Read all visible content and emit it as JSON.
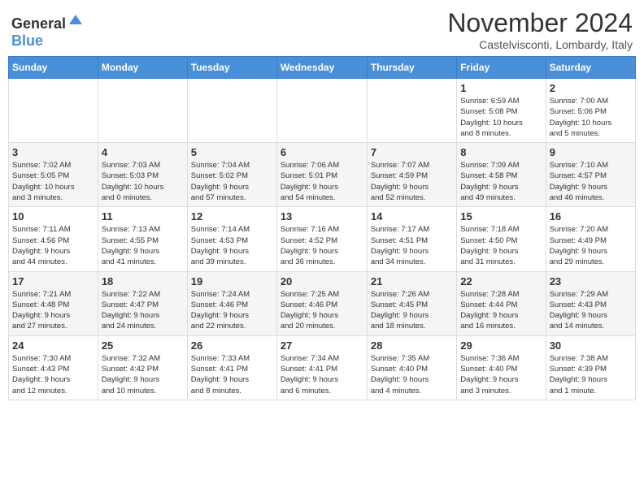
{
  "header": {
    "logo_general": "General",
    "logo_blue": "Blue",
    "title": "November 2024",
    "subtitle": "Castelvisconti, Lombardy, Italy"
  },
  "columns": [
    "Sunday",
    "Monday",
    "Tuesday",
    "Wednesday",
    "Thursday",
    "Friday",
    "Saturday"
  ],
  "rows": [
    {
      "cells": [
        {
          "day": "",
          "info": ""
        },
        {
          "day": "",
          "info": ""
        },
        {
          "day": "",
          "info": ""
        },
        {
          "day": "",
          "info": ""
        },
        {
          "day": "",
          "info": ""
        },
        {
          "day": "1",
          "info": "Sunrise: 6:59 AM\nSunset: 5:08 PM\nDaylight: 10 hours\nand 8 minutes."
        },
        {
          "day": "2",
          "info": "Sunrise: 7:00 AM\nSunset: 5:06 PM\nDaylight: 10 hours\nand 5 minutes."
        }
      ]
    },
    {
      "cells": [
        {
          "day": "3",
          "info": "Sunrise: 7:02 AM\nSunset: 5:05 PM\nDaylight: 10 hours\nand 3 minutes."
        },
        {
          "day": "4",
          "info": "Sunrise: 7:03 AM\nSunset: 5:03 PM\nDaylight: 10 hours\nand 0 minutes."
        },
        {
          "day": "5",
          "info": "Sunrise: 7:04 AM\nSunset: 5:02 PM\nDaylight: 9 hours\nand 57 minutes."
        },
        {
          "day": "6",
          "info": "Sunrise: 7:06 AM\nSunset: 5:01 PM\nDaylight: 9 hours\nand 54 minutes."
        },
        {
          "day": "7",
          "info": "Sunrise: 7:07 AM\nSunset: 4:59 PM\nDaylight: 9 hours\nand 52 minutes."
        },
        {
          "day": "8",
          "info": "Sunrise: 7:09 AM\nSunset: 4:58 PM\nDaylight: 9 hours\nand 49 minutes."
        },
        {
          "day": "9",
          "info": "Sunrise: 7:10 AM\nSunset: 4:57 PM\nDaylight: 9 hours\nand 46 minutes."
        }
      ]
    },
    {
      "cells": [
        {
          "day": "10",
          "info": "Sunrise: 7:11 AM\nSunset: 4:56 PM\nDaylight: 9 hours\nand 44 minutes."
        },
        {
          "day": "11",
          "info": "Sunrise: 7:13 AM\nSunset: 4:55 PM\nDaylight: 9 hours\nand 41 minutes."
        },
        {
          "day": "12",
          "info": "Sunrise: 7:14 AM\nSunset: 4:53 PM\nDaylight: 9 hours\nand 39 minutes."
        },
        {
          "day": "13",
          "info": "Sunrise: 7:16 AM\nSunset: 4:52 PM\nDaylight: 9 hours\nand 36 minutes."
        },
        {
          "day": "14",
          "info": "Sunrise: 7:17 AM\nSunset: 4:51 PM\nDaylight: 9 hours\nand 34 minutes."
        },
        {
          "day": "15",
          "info": "Sunrise: 7:18 AM\nSunset: 4:50 PM\nDaylight: 9 hours\nand 31 minutes."
        },
        {
          "day": "16",
          "info": "Sunrise: 7:20 AM\nSunset: 4:49 PM\nDaylight: 9 hours\nand 29 minutes."
        }
      ]
    },
    {
      "cells": [
        {
          "day": "17",
          "info": "Sunrise: 7:21 AM\nSunset: 4:48 PM\nDaylight: 9 hours\nand 27 minutes."
        },
        {
          "day": "18",
          "info": "Sunrise: 7:22 AM\nSunset: 4:47 PM\nDaylight: 9 hours\nand 24 minutes."
        },
        {
          "day": "19",
          "info": "Sunrise: 7:24 AM\nSunset: 4:46 PM\nDaylight: 9 hours\nand 22 minutes."
        },
        {
          "day": "20",
          "info": "Sunrise: 7:25 AM\nSunset: 4:46 PM\nDaylight: 9 hours\nand 20 minutes."
        },
        {
          "day": "21",
          "info": "Sunrise: 7:26 AM\nSunset: 4:45 PM\nDaylight: 9 hours\nand 18 minutes."
        },
        {
          "day": "22",
          "info": "Sunrise: 7:28 AM\nSunset: 4:44 PM\nDaylight: 9 hours\nand 16 minutes."
        },
        {
          "day": "23",
          "info": "Sunrise: 7:29 AM\nSunset: 4:43 PM\nDaylight: 9 hours\nand 14 minutes."
        }
      ]
    },
    {
      "cells": [
        {
          "day": "24",
          "info": "Sunrise: 7:30 AM\nSunset: 4:43 PM\nDaylight: 9 hours\nand 12 minutes."
        },
        {
          "day": "25",
          "info": "Sunrise: 7:32 AM\nSunset: 4:42 PM\nDaylight: 9 hours\nand 10 minutes."
        },
        {
          "day": "26",
          "info": "Sunrise: 7:33 AM\nSunset: 4:41 PM\nDaylight: 9 hours\nand 8 minutes."
        },
        {
          "day": "27",
          "info": "Sunrise: 7:34 AM\nSunset: 4:41 PM\nDaylight: 9 hours\nand 6 minutes."
        },
        {
          "day": "28",
          "info": "Sunrise: 7:35 AM\nSunset: 4:40 PM\nDaylight: 9 hours\nand 4 minutes."
        },
        {
          "day": "29",
          "info": "Sunrise: 7:36 AM\nSunset: 4:40 PM\nDaylight: 9 hours\nand 3 minutes."
        },
        {
          "day": "30",
          "info": "Sunrise: 7:38 AM\nSunset: 4:39 PM\nDaylight: 9 hours\nand 1 minute."
        }
      ]
    }
  ]
}
